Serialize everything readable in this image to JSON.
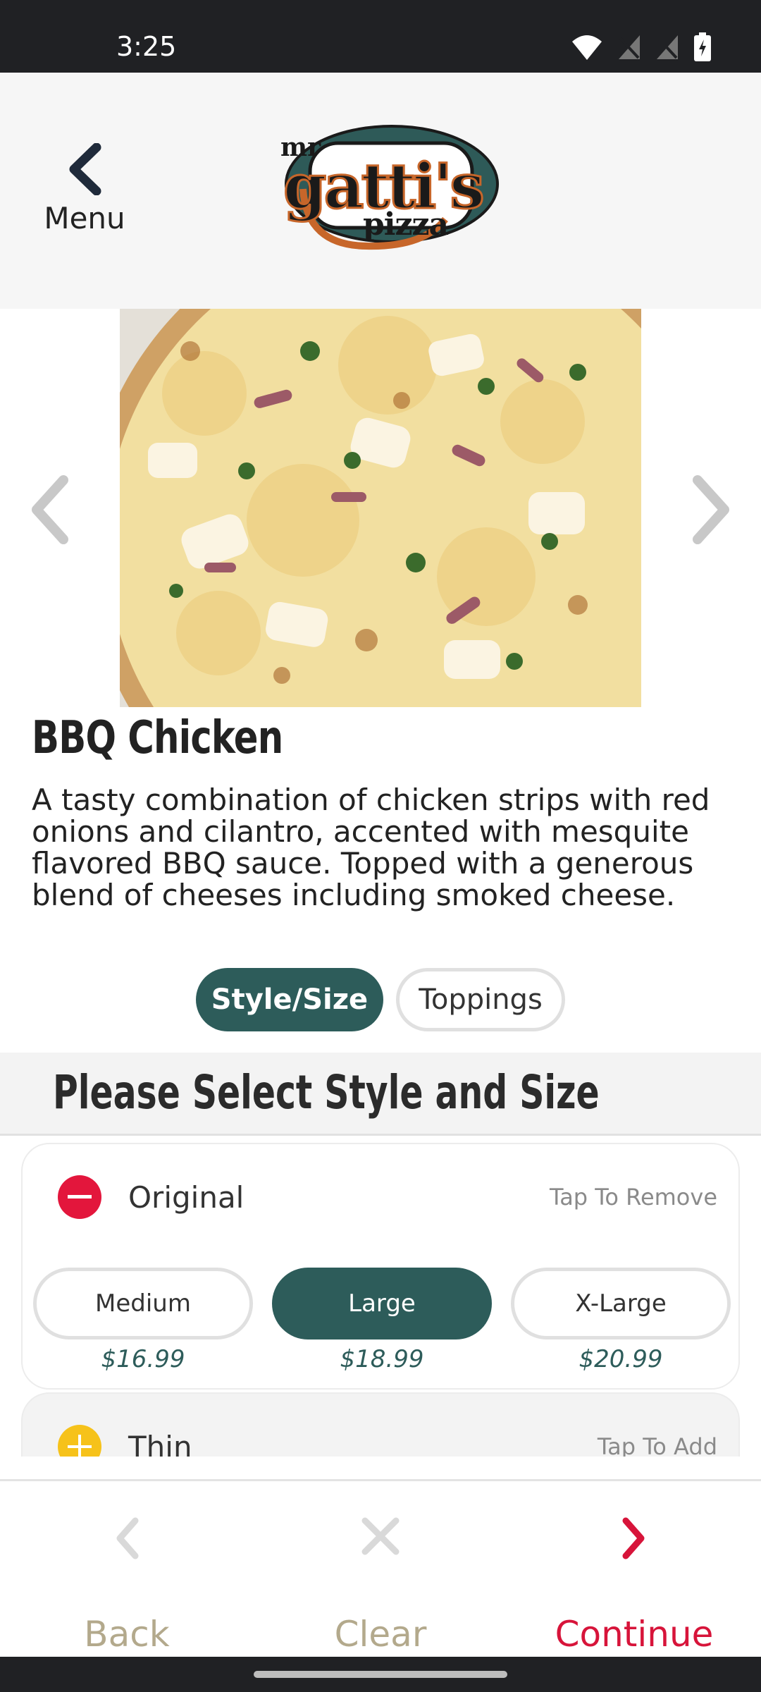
{
  "status_bar": {
    "time": "3:25"
  },
  "header": {
    "back_label": "Menu",
    "logo_text_top": "mr",
    "logo_text_main": "gatti's",
    "logo_text_bottom": "pizza"
  },
  "item": {
    "name": "BBQ Chicken",
    "description": "A tasty combination of chicken strips with red onions and cilantro, accented with mesquite flavored BBQ sauce. Topped with a generous blend of cheeses including smoked cheese."
  },
  "tabs": [
    {
      "label": "Style/Size",
      "active": true
    },
    {
      "label": "Toppings",
      "active": false
    }
  ],
  "section": {
    "title": "Please Select Style and Size"
  },
  "styles": [
    {
      "label": "Original",
      "action": "Tap To Remove",
      "selected": true,
      "sizes": [
        {
          "label": "Medium",
          "price": "$16.99",
          "selected": false
        },
        {
          "label": "Large",
          "price": "$18.99",
          "selected": true
        },
        {
          "label": "X-Large",
          "price": "$20.99",
          "selected": false
        }
      ]
    },
    {
      "label": "Thin",
      "action": "Tap To Add",
      "selected": false
    }
  ],
  "bottom_actions": {
    "back": "Back",
    "clear": "Clear",
    "continue": "Continue"
  },
  "colors": {
    "brand_teal": "#2d5c5a",
    "accent_red": "#d7143a",
    "muted_gold": "#b3a98c",
    "add_yellow": "#f6c21a",
    "remove_red": "#e3163c"
  }
}
